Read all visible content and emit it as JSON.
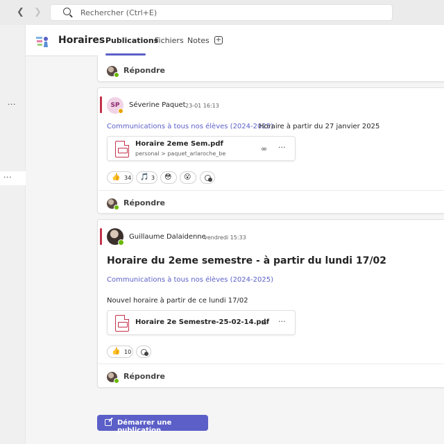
{
  "search": {
    "placeholder": "Rechercher (Ctrl+E)"
  },
  "nav": {
    "back_icon": "chevron-left-icon",
    "forward_icon": "chevron-right-icon"
  },
  "leftrail": {
    "more_label_1": "···",
    "more_label_2": "···"
  },
  "header": {
    "team_name": "Horaires",
    "tabs": [
      {
        "label": "Publications",
        "active": true
      },
      {
        "label": "Fichiers"
      },
      {
        "label": "Notes"
      }
    ],
    "add_tab_label": "+"
  },
  "colors": {
    "accent": "#5b5fc7",
    "card_accent": "#c4314b",
    "away": "#eaa300",
    "available": "#6bb700"
  },
  "reply_label": "Répondre",
  "posts": [
    {
      "author_initials": "SP",
      "author": "Séverine Paquet",
      "time": "23-01 16:13",
      "channel": "Communications à tous nos élèves (2024-2025)",
      "text": "Horaire à partir du 27 janvier 2025",
      "attachment": {
        "name": "Horaire 2eme Sem.pdf",
        "path": "personal > paquet_arlaroche_be"
      },
      "reactions": [
        {
          "icon": "thumbs-up",
          "emoji": "👍",
          "count": "34"
        },
        {
          "icon": "music-note",
          "emoji": "🎵",
          "count": "3"
        },
        {
          "icon": "blushing-face",
          "emoji": "😳",
          "count": ""
        },
        {
          "icon": "surprised-face",
          "emoji": "😮",
          "count": ""
        }
      ]
    },
    {
      "author": "Guillaume Dalaidenne",
      "time": "vendredi 15:33",
      "title": "Horaire du 2eme semestre - à partir du lundi 17/02",
      "channel": "Communications à tous nos élèves (2024-2025)",
      "text": "Nouvel horaire à partir de ce lundi 17/02",
      "attachment": {
        "name": "Horaire 2e Semestre-25-02-14.pdf"
      },
      "reactions": [
        {
          "icon": "thumbs-up",
          "emoji": "👍",
          "count": "10"
        }
      ]
    }
  ],
  "start_post_label": "Démarrer une publication"
}
